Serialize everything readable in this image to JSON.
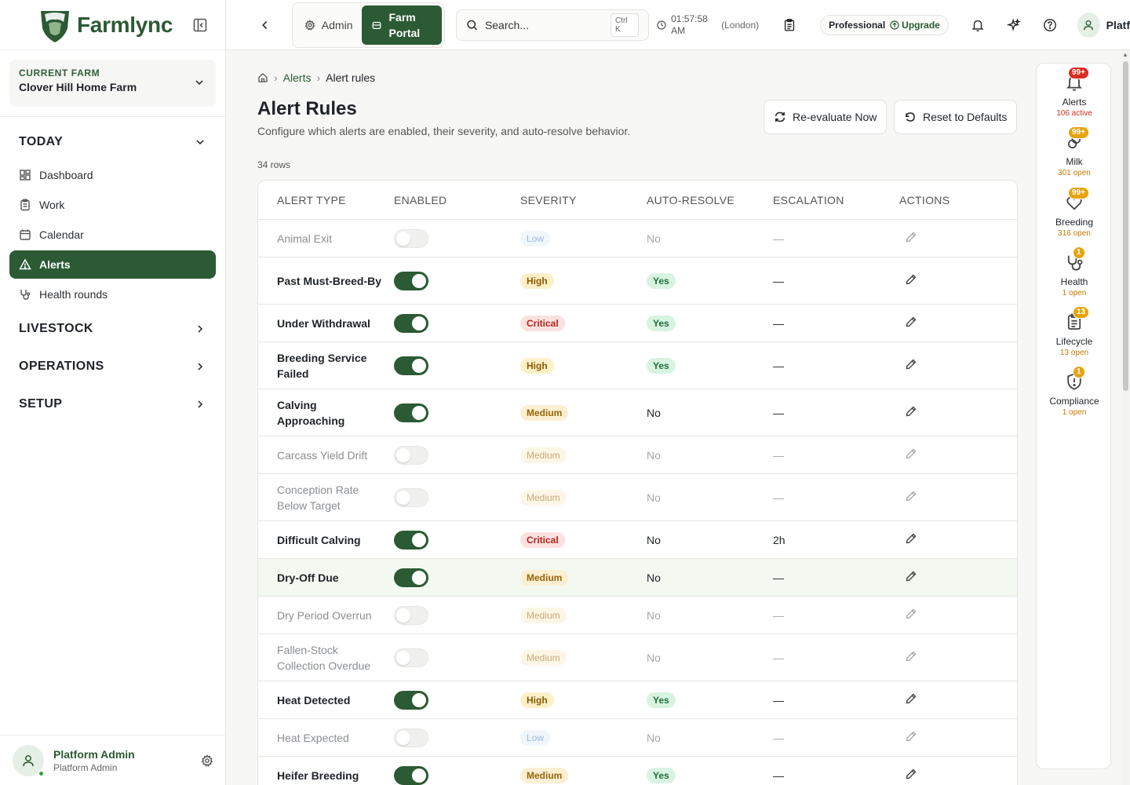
{
  "brand": {
    "name": "Farmlync",
    "color": "#2b5a34"
  },
  "sidebar": {
    "farm_label": "CURRENT FARM",
    "farm_name": "Clover Hill Home Farm",
    "groups": [
      {
        "label": "TODAY",
        "items": [
          {
            "label": "Dashboard",
            "icon": "dashboard-icon"
          },
          {
            "label": "Work",
            "icon": "clipboard-icon"
          },
          {
            "label": "Calendar",
            "icon": "calendar-icon"
          },
          {
            "label": "Alerts",
            "icon": "alert-triangle-icon",
            "active": true
          },
          {
            "label": "Health rounds",
            "icon": "stethoscope-icon"
          }
        ]
      },
      {
        "label": "LIVESTOCK"
      },
      {
        "label": "OPERATIONS"
      },
      {
        "label": "SETUP"
      }
    ],
    "user_name": "Platform Admin",
    "user_role": "Platform Admin"
  },
  "topbar": {
    "admin_label": "Admin",
    "portal_label": "Farm Portal",
    "search_placeholder": "Search...",
    "search_shortcut": "Ctrl K",
    "time": "01:57:58 AM",
    "timezone": "(London)",
    "plan": "Professional",
    "upgrade": "Upgrade",
    "user_short": "Platf"
  },
  "breadcrumb": {
    "link": "Alerts",
    "current": "Alert rules"
  },
  "page": {
    "title": "Alert Rules",
    "subtitle": "Configure which alerts are enabled, their severity, and auto-resolve behavior.",
    "reevaluate_label": "Re-evaluate Now",
    "reset_label": "Reset to Defaults",
    "row_count": "34 rows"
  },
  "table": {
    "headers": [
      "ALERT TYPE",
      "ENABLED",
      "SEVERITY",
      "AUTO-RESOLVE",
      "ESCALATION",
      "ACTIONS"
    ],
    "rows": [
      {
        "type": "Animal Exit",
        "enabled": false,
        "severity": "Low",
        "auto": "No",
        "esc": "—"
      },
      {
        "type": "Past Must-Breed-By",
        "enabled": true,
        "severity": "High",
        "auto": "Yes",
        "esc": "—"
      },
      {
        "type": "Under Withdrawal",
        "enabled": true,
        "severity": "Critical",
        "auto": "Yes",
        "esc": "—"
      },
      {
        "type": "Breeding Service Failed",
        "enabled": true,
        "severity": "High",
        "auto": "Yes",
        "esc": "—"
      },
      {
        "type": "Calving Approaching",
        "enabled": true,
        "severity": "Medium",
        "auto": "No",
        "esc": "—"
      },
      {
        "type": "Carcass Yield Drift",
        "enabled": false,
        "severity": "Medium",
        "auto": "No",
        "esc": "—"
      },
      {
        "type": "Conception Rate Below Target",
        "enabled": false,
        "severity": "Medium",
        "auto": "No",
        "esc": "—"
      },
      {
        "type": "Difficult Calving",
        "enabled": true,
        "severity": "Critical",
        "auto": "No",
        "esc": "2h"
      },
      {
        "type": "Dry-Off Due",
        "enabled": true,
        "severity": "Medium",
        "auto": "No",
        "esc": "—",
        "highlight": true
      },
      {
        "type": "Dry Period Overrun",
        "enabled": false,
        "severity": "Medium",
        "auto": "No",
        "esc": "—"
      },
      {
        "type": "Fallen-Stock Collection Overdue",
        "enabled": false,
        "severity": "Medium",
        "auto": "No",
        "esc": "—"
      },
      {
        "type": "Heat Detected",
        "enabled": true,
        "severity": "High",
        "auto": "Yes",
        "esc": "—"
      },
      {
        "type": "Heat Expected",
        "enabled": false,
        "severity": "Low",
        "auto": "No",
        "esc": "—"
      },
      {
        "type": "Heifer Breeding",
        "enabled": true,
        "severity": "Medium",
        "auto": "Yes",
        "esc": "—"
      }
    ]
  },
  "rail": [
    {
      "label": "Alerts",
      "icon": "bell-icon",
      "badge": "99+",
      "badge_color": "#d92d20",
      "sub": "106 active",
      "sub_color": "#d92d20"
    },
    {
      "label": "Milk",
      "icon": "milk-drop-icon",
      "badge": "99+",
      "badge_color": "#e8a30c",
      "sub": "301 open",
      "sub_color": "#c77800"
    },
    {
      "label": "Breeding",
      "icon": "heart-icon",
      "badge": "99+",
      "badge_color": "#e8a30c",
      "sub": "316 open",
      "sub_color": "#c77800"
    },
    {
      "label": "Health",
      "icon": "stethoscope-icon",
      "badge": "1",
      "badge_color": "#e8a30c",
      "sub": "1 open",
      "sub_color": "#c77800"
    },
    {
      "label": "Lifecycle",
      "icon": "clipboard-icon",
      "badge": "13",
      "badge_color": "#e8a30c",
      "sub": "13 open",
      "sub_color": "#c77800"
    },
    {
      "label": "Compliance",
      "icon": "shield-icon",
      "badge": "1",
      "badge_color": "#e8a30c",
      "sub": "1 open",
      "sub_color": "#c77800"
    }
  ]
}
